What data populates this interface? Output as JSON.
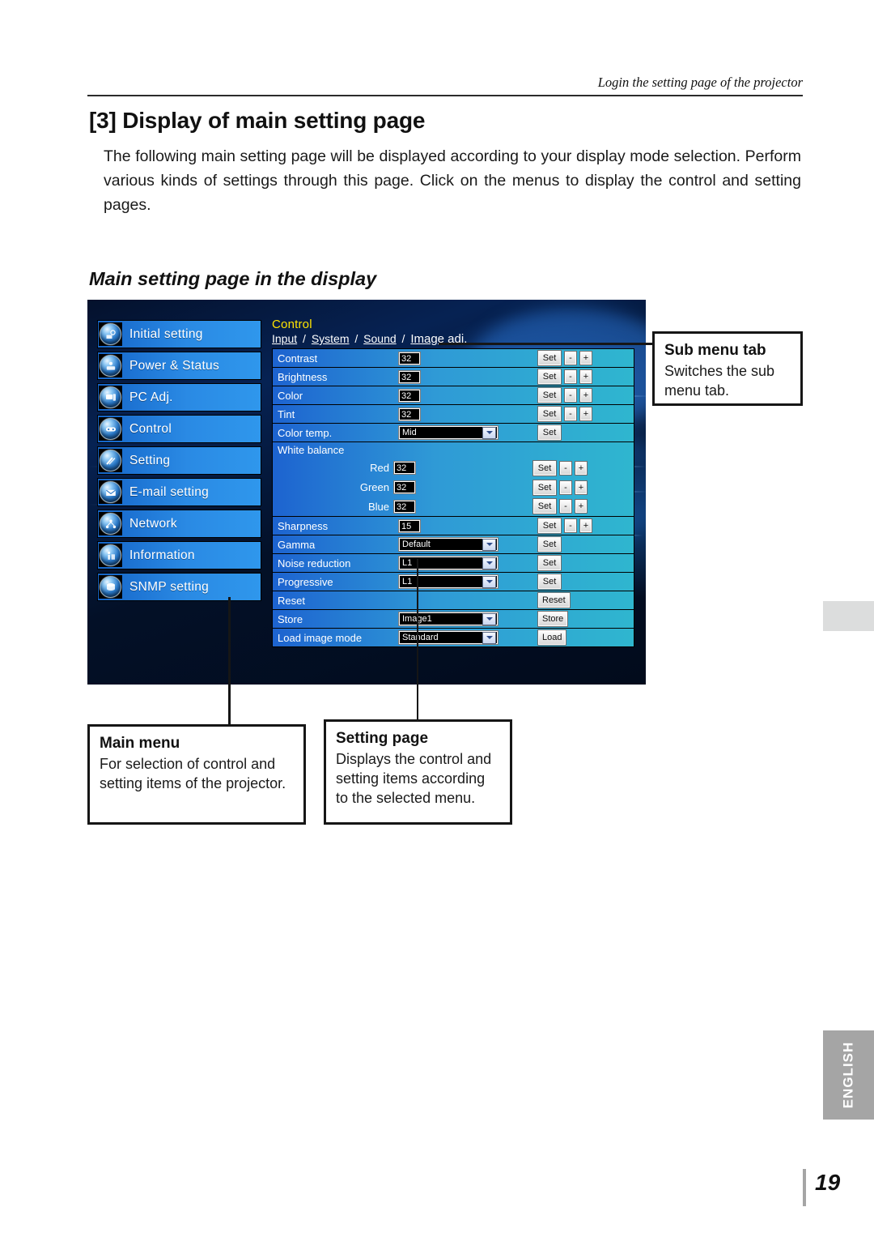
{
  "header": {
    "running_head": "Login the setting page of the projector"
  },
  "section": {
    "title": "[3] Display of main setting page",
    "intro": "The following main setting page will be displayed according to your display mode selection. Perform various kinds of settings through this page. Click on the menus to display the control and setting pages.",
    "subtitle": "Main setting page in the display"
  },
  "projector_ui": {
    "main_menu": [
      {
        "label": "Initial setting",
        "icon": "gear-globe-icon"
      },
      {
        "label": "Power & Status",
        "icon": "power-globe-icon"
      },
      {
        "label": "PC Adj.",
        "icon": "monitor-globe-icon"
      },
      {
        "label": "Control",
        "icon": "remote-globe-icon"
      },
      {
        "label": "Setting",
        "icon": "tools-globe-icon"
      },
      {
        "label": "E-mail setting",
        "icon": "envelope-globe-icon"
      },
      {
        "label": "Network",
        "icon": "network-globe-icon"
      },
      {
        "label": "Information",
        "icon": "info-globe-icon"
      },
      {
        "label": "SNMP setting",
        "icon": "snmp-globe-icon"
      }
    ],
    "setting_page": {
      "heading": "Control",
      "tabs": [
        {
          "label": "Input",
          "active": false
        },
        {
          "label": "System",
          "active": false
        },
        {
          "label": "Sound",
          "active": false
        },
        {
          "label": "Image adj.",
          "active": true
        }
      ],
      "tab_separator": "/",
      "rows": [
        {
          "label": "Contrast",
          "type": "number",
          "value": "32",
          "buttons": [
            "Set",
            "-",
            "+"
          ]
        },
        {
          "label": "Brightness",
          "type": "number",
          "value": "32",
          "buttons": [
            "Set",
            "-",
            "+"
          ]
        },
        {
          "label": "Color",
          "type": "number",
          "value": "32",
          "buttons": [
            "Set",
            "-",
            "+"
          ]
        },
        {
          "label": "Tint",
          "type": "number",
          "value": "32",
          "buttons": [
            "Set",
            "-",
            "+"
          ]
        },
        {
          "label": "Color temp.",
          "type": "select",
          "value": "Mid",
          "buttons": [
            "Set"
          ]
        },
        {
          "label": "Sharpness",
          "type": "number",
          "value": "15",
          "buttons": [
            "Set",
            "-",
            "+"
          ]
        },
        {
          "label": "Gamma",
          "type": "select",
          "value": "Default",
          "buttons": [
            "Set"
          ]
        },
        {
          "label": "Noise reduction",
          "type": "select",
          "value": "L1",
          "buttons": [
            "Set"
          ]
        },
        {
          "label": "Progressive",
          "type": "select",
          "value": "L1",
          "buttons": [
            "Set"
          ]
        },
        {
          "label": "Reset",
          "type": "none",
          "value": "",
          "buttons": [
            "Reset"
          ]
        },
        {
          "label": "Store",
          "type": "select",
          "value": "Image1",
          "buttons": [
            "Store"
          ]
        },
        {
          "label": "Load image mode",
          "type": "select",
          "value": "Standard",
          "buttons": [
            "Load"
          ]
        }
      ],
      "white_balance": {
        "label": "White balance",
        "channels": [
          {
            "name": "Red",
            "value": "32",
            "buttons": [
              "Set",
              "-",
              "+"
            ]
          },
          {
            "name": "Green",
            "value": "32",
            "buttons": [
              "Set",
              "-",
              "+"
            ]
          },
          {
            "name": "Blue",
            "value": "32",
            "buttons": [
              "Set",
              "-",
              "+"
            ]
          }
        ]
      }
    }
  },
  "callouts": {
    "submenu": {
      "title": "Sub menu tab",
      "body": "Switches the sub menu tab."
    },
    "main_menu": {
      "title": "Main menu",
      "body": "For selection of  control and setting items of the projector."
    },
    "setting_page": {
      "title": "Setting page",
      "body": "Displays the control and setting items according to the selected menu."
    }
  },
  "footer": {
    "language_tab": "ENGLISH",
    "page_number": "19"
  },
  "colors": {
    "accent_yellow": "#ffe400",
    "menu_blue": "#2a8ae4",
    "row_blue": "#1d63d0",
    "row_cyan": "#2fb6cf",
    "tab_gray": "#a5a5a5"
  }
}
